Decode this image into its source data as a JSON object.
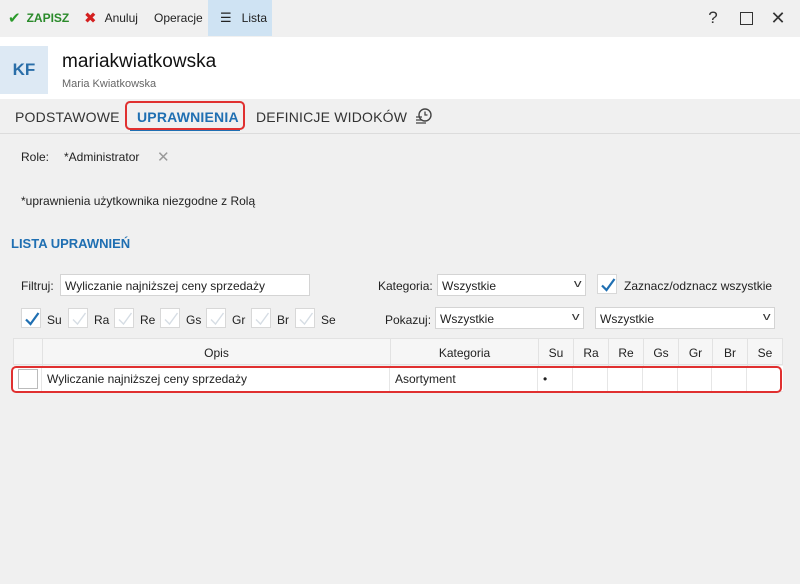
{
  "toolbar": {
    "save_label": "ZAPISZ",
    "cancel_label": "Anuluj",
    "operations_label": "Operacje",
    "list_label": "Lista"
  },
  "header": {
    "initials": "KF",
    "login": "mariakwiatkowska",
    "full_name": "Maria Kwiatkowska"
  },
  "tabs": [
    {
      "label": "PODSTAWOWE",
      "active": false
    },
    {
      "label": "UPRAWNIENIA",
      "active": true
    },
    {
      "label": "DEFINICJE WIDOKÓW",
      "active": false
    }
  ],
  "role": {
    "label": "Role:",
    "value": "*Administrator"
  },
  "note": "*uprawnienia użytkownika niezgodne z Rolą",
  "section_title": "LISTA UPRAWNIEŃ",
  "filters": {
    "filter_label": "Filtruj:",
    "filter_value": "Wyliczanie najniższej ceny sprzedaży",
    "category_label": "Kategoria:",
    "category_value": "Wszystkie",
    "select_all_label": "Zaznacz/odznacz wszystkie",
    "show_label": "Pokazuj:",
    "show_value_1": "Wszystkie",
    "show_value_2": "Wszystkie",
    "rights": [
      {
        "label": "Su",
        "checked": true
      },
      {
        "label": "Ra",
        "checked": false
      },
      {
        "label": "Re",
        "checked": false
      },
      {
        "label": "Gs",
        "checked": false
      },
      {
        "label": "Gr",
        "checked": false
      },
      {
        "label": "Br",
        "checked": false
      },
      {
        "label": "Se",
        "checked": false
      }
    ]
  },
  "grid": {
    "headers": {
      "opis": "Opis",
      "kategoria": "Kategoria",
      "rights": [
        "Su",
        "Ra",
        "Re",
        "Gs",
        "Gr",
        "Br",
        "Se"
      ]
    },
    "rows": [
      {
        "opis": "Wyliczanie najniższej ceny sprzedaży",
        "kategoria": "Asortyment",
        "rights": [
          "•",
          "",
          "",
          "",
          "",
          "",
          ""
        ]
      }
    ]
  },
  "colors": {
    "accent": "#1f6fb2",
    "save_green": "#2a8a2a",
    "cancel_red": "#d42020",
    "highlight_red": "#e03030"
  }
}
